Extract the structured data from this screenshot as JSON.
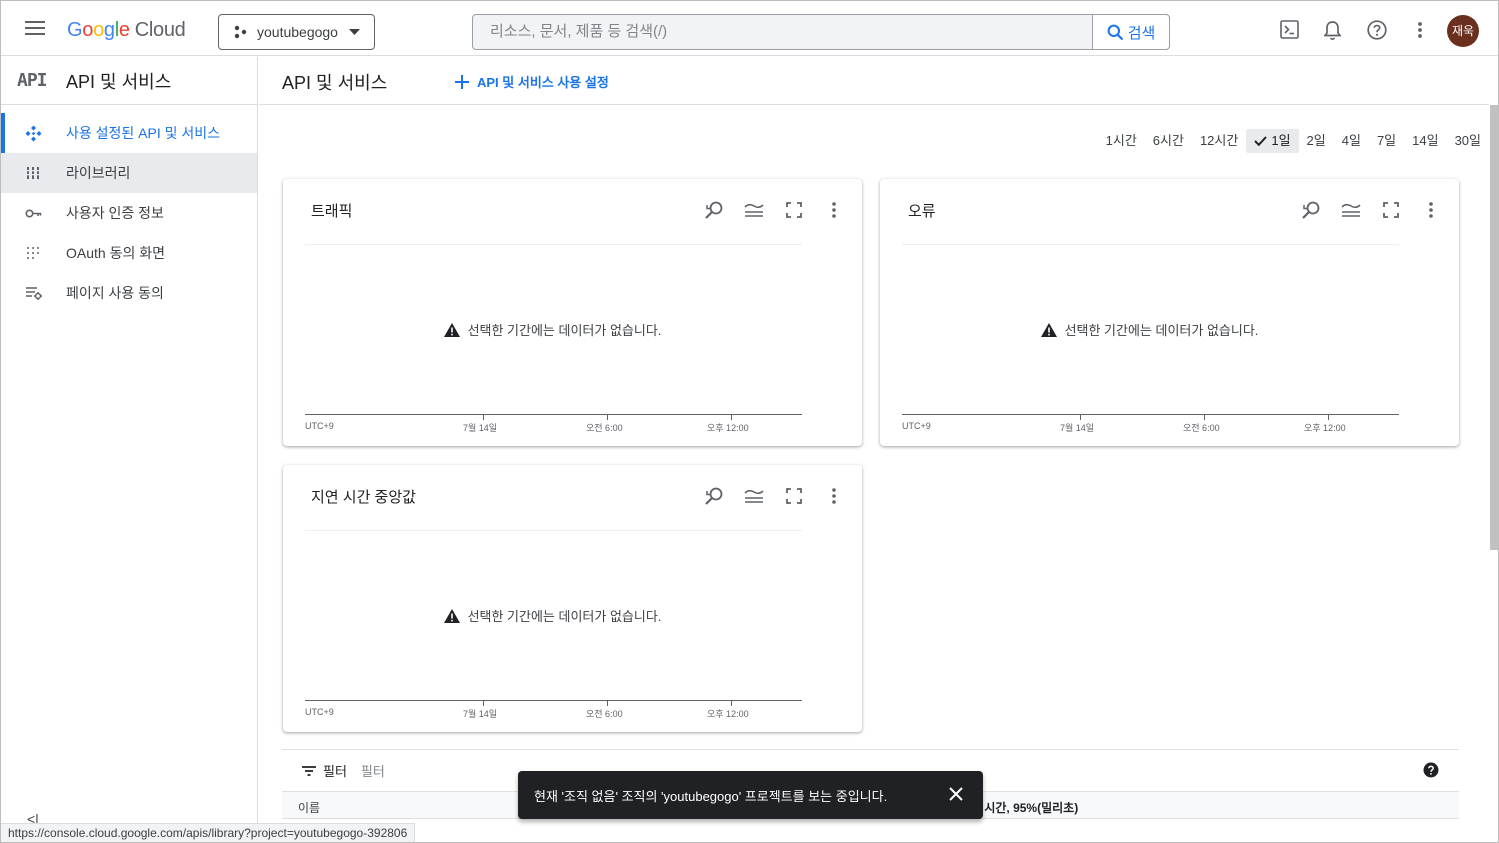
{
  "header": {
    "logo_google": [
      "G",
      "o",
      "o",
      "g",
      "l",
      "e"
    ],
    "logo_cloud": "Cloud",
    "project": "youtubegogo",
    "search_placeholder": "리소스, 문서, 제품 등 검색(/)",
    "search_button": "검색",
    "avatar": "재욱",
    "icons": [
      "menu-icon",
      "terminal-icon",
      "bell-icon",
      "help-icon",
      "more-vert-icon"
    ]
  },
  "sidebar": {
    "logo_text": "API",
    "title": "API 및 서비스",
    "items": [
      {
        "label": "사용 설정된 API 및 서비스",
        "icon": "api-diamond-icon"
      },
      {
        "label": "라이브러리",
        "icon": "library-icon"
      },
      {
        "label": "사용자 인증 정보",
        "icon": "key-icon"
      },
      {
        "label": "OAuth 동의 화면",
        "icon": "dotted-grid-icon"
      },
      {
        "label": "페이지 사용 동의",
        "icon": "settings-list-icon"
      }
    ],
    "collapse": "<|"
  },
  "main": {
    "title": "API 및 서비스",
    "enable_label": "API 및 서비스 사용 설정",
    "time_ranges": [
      "1시간",
      "6시간",
      "12시간",
      "1일",
      "2일",
      "4일",
      "7일",
      "14일",
      "30일"
    ],
    "selected_range": "1일",
    "cards": [
      {
        "title": "트래픽",
        "nodata": "선택한 기간에는 데이터가 없습니다.",
        "ticks": [
          "UTC+9",
          "7월 14일",
          "오전 6:00",
          "오후 12:00"
        ]
      },
      {
        "title": "오류",
        "nodata": "선택한 기간에는 데이터가 없습니다.",
        "ticks": [
          "UTC+9",
          "7월 14일",
          "오전 6:00",
          "오후 12:00"
        ]
      },
      {
        "title": "지연 시간 중앙값",
        "nodata": "선택한 기간에는 데이터가 없습니다.",
        "ticks": [
          "UTC+9",
          "7월 14일",
          "오전 6:00",
          "오후 12:00"
        ]
      }
    ],
    "filter_label": "필터",
    "filter_placeholder": "필터",
    "table_col_name": "이름",
    "table_col_latency": "! 시간, 95%(밀리초)"
  },
  "toast": {
    "message": "현재 '조직 없음' 조직의 'youtubegogo' 프로젝트를 보는 중입니다."
  },
  "status_url": "https://console.cloud.google.com/apis/library?project=youtubegogo-392806",
  "colors": {
    "accent": "#1a73e8",
    "avatar_bg": "#6b2f1e",
    "toast_bg": "#202124"
  }
}
